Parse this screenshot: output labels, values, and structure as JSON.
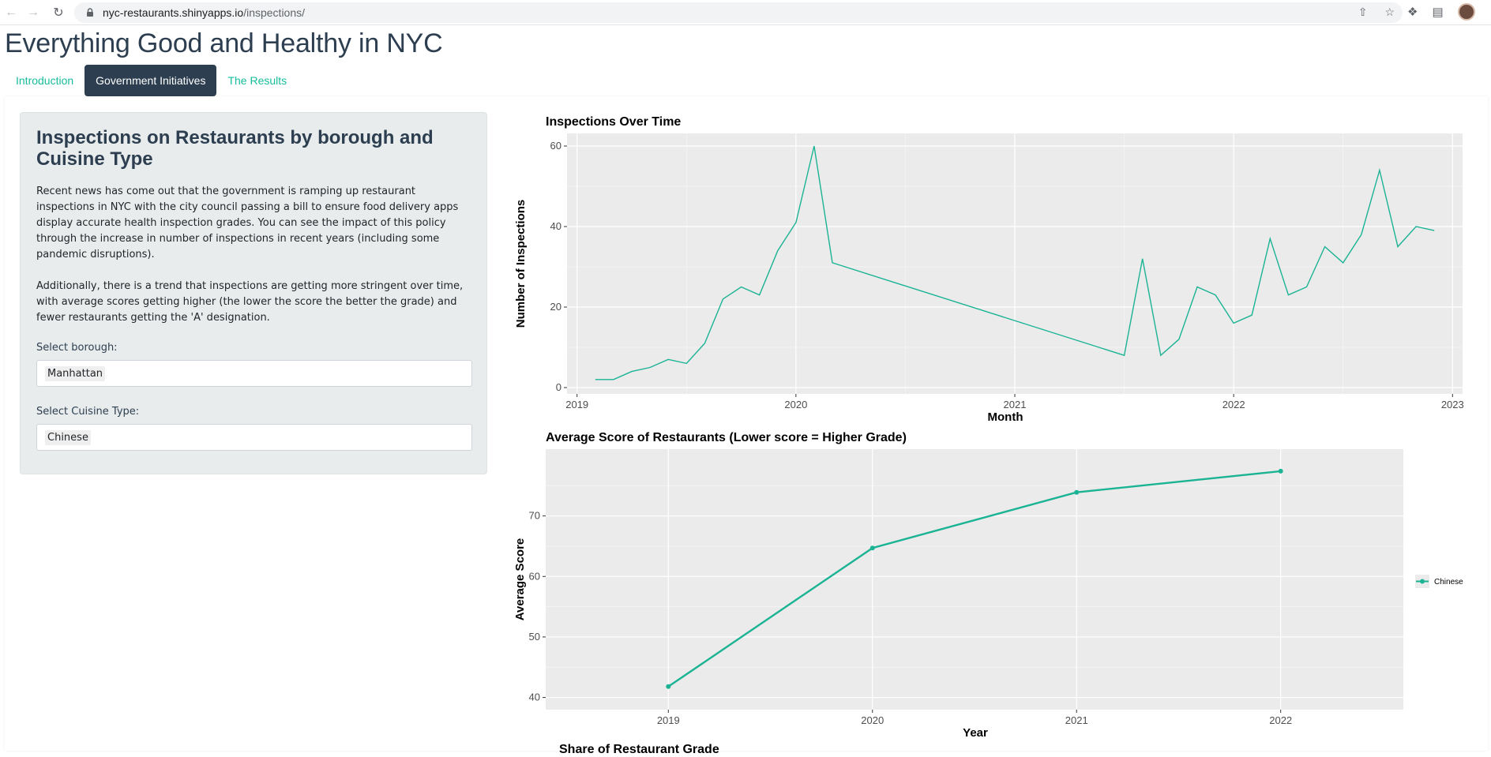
{
  "browser": {
    "url_host": "nyc-restaurants.shinyapps.io",
    "url_path": "/inspections/"
  },
  "page": {
    "title": "Everything Good and Healthy in NYC",
    "tabs": [
      {
        "label": "Introduction",
        "active": false
      },
      {
        "label": "Government Initiatives",
        "active": true
      },
      {
        "label": "The Results",
        "active": false
      }
    ]
  },
  "sidebar": {
    "heading": "Inspections on Restaurants by borough and Cuisine Type",
    "paragraph1": "Recent news has come out that the government is ramping up restaurant inspections in NYC with the city council passing a bill to ensure food delivery apps display accurate health inspection grades. You can see the impact of this policy through the increase in number of inspections in recent years (including some pandemic disruptions).",
    "paragraph2": "Additionally, there is a trend that inspections are getting more stringent over time, with average scores getting higher (the lower the score the better the grade) and fewer restaurants getting the 'A' designation.",
    "borough_label": "Select borough:",
    "borough_value": "Manhattan",
    "cuisine_label": "Select Cuisine Type:",
    "cuisine_value": "Chinese"
  },
  "colors": {
    "accent": "#18bc9c",
    "navy": "#2c3e50",
    "panel_bg": "#e8ecec",
    "plot_bg": "#ebebeb",
    "line": "#1ab394"
  },
  "chart_data": [
    {
      "type": "line",
      "title": "Inspections Over Time",
      "xlabel": "Month",
      "ylabel": "Number of Inspections",
      "xticks": [
        "2019",
        "2020",
        "2021",
        "2022",
        "2023"
      ],
      "yticks": [
        0,
        20,
        40,
        60
      ],
      "xlim": [
        "2018-12",
        "2023-01"
      ],
      "ylim": [
        0,
        60
      ],
      "series": [
        {
          "x": [
            "2019-02",
            "2019-03",
            "2019-04",
            "2019-05",
            "2019-06",
            "2019-07",
            "2019-08",
            "2019-09",
            "2019-10",
            "2019-11",
            "2019-12",
            "2020-01",
            "2020-02",
            "2020-03",
            "2021-07",
            "2021-08",
            "2021-09",
            "2021-10",
            "2021-11",
            "2021-12",
            "2022-01",
            "2022-02",
            "2022-03",
            "2022-04",
            "2022-05",
            "2022-06",
            "2022-07",
            "2022-08",
            "2022-09",
            "2022-10",
            "2022-11",
            "2022-12"
          ],
          "values": [
            2,
            2,
            4,
            5,
            7,
            6,
            11,
            22,
            25,
            23,
            34,
            41,
            60,
            31,
            8,
            32,
            8,
            12,
            25,
            23,
            16,
            18,
            37,
            23,
            25,
            35,
            31,
            38,
            54,
            35,
            40,
            39
          ]
        }
      ]
    },
    {
      "type": "line",
      "title": "Average Score of Restaurants (Lower score = Higher Grade)",
      "xlabel": "Year",
      "ylabel": "Average Score",
      "categories": [
        "2019",
        "2020",
        "2021",
        "2022"
      ],
      "yticks": [
        40,
        50,
        60,
        70
      ],
      "ylim": [
        40,
        79
      ],
      "series": [
        {
          "name": "Chinese",
          "values": [
            41.8,
            64.7,
            73.9,
            77.4
          ]
        }
      ],
      "legend": "right"
    }
  ],
  "next_section_title": "Share of Restaurant Grade"
}
